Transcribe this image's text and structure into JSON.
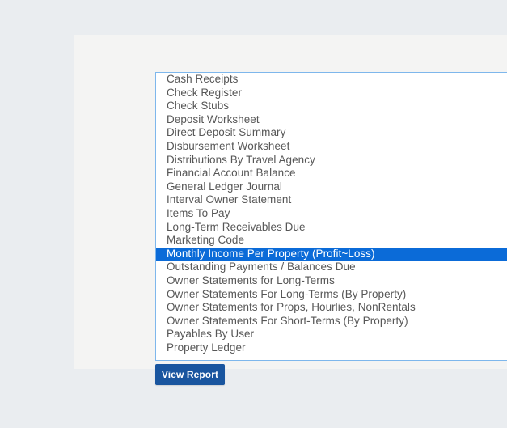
{
  "page": {
    "background_color": "#eaedf0",
    "panel_color": "#f4f4f3"
  },
  "report_selector": {
    "name": "report-list",
    "border_color": "#7eb7ec",
    "selected_index": 13,
    "selected_value": "Monthly Income Per Property (Profit~Loss)",
    "highlight_color": "#0b6bd8",
    "highlight_text_color": "#ffffff",
    "option_text_color": "#575757",
    "options": [
      "Cash Receipts",
      "Check Register",
      "Check Stubs",
      "Deposit Worksheet",
      "Direct Deposit Summary",
      "Disbursement Worksheet",
      "Distributions By Travel Agency",
      "Financial Account Balance",
      "General Ledger Journal",
      "Interval Owner Statement",
      "Items To Pay",
      "Long-Term Receivables Due",
      "Marketing Code",
      "Monthly Income Per Property (Profit~Loss)",
      "Outstanding Payments / Balances Due",
      "Owner Statements for Long-Terms",
      "Owner Statements For Long-Terms (By Property)",
      "Owner Statements for Props, Hourlies, NonRentals",
      "Owner Statements For Short-Terms (By Property)",
      "Payables By User",
      "Property Ledger"
    ]
  },
  "actions": {
    "view_report_label": "View Report",
    "view_report_color": "#19559f"
  }
}
